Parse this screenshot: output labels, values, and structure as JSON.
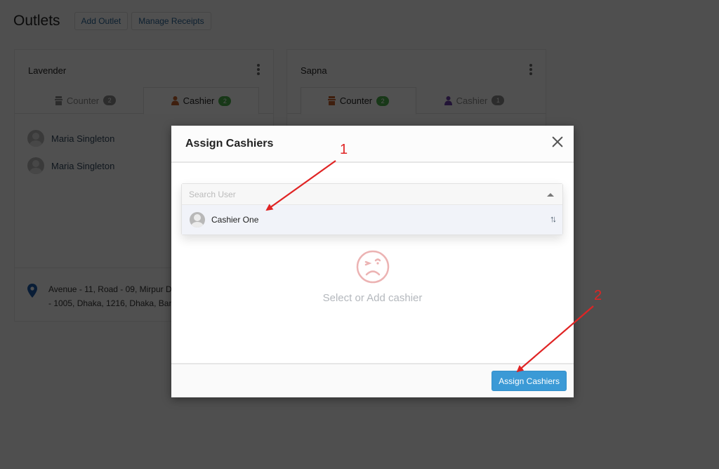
{
  "page": {
    "title": "Outlets",
    "buttons": [
      "Add Outlet",
      "Manage Receipts"
    ]
  },
  "outlets": [
    {
      "name": "Lavender",
      "tabs": [
        {
          "label": "Counter",
          "count": "2",
          "active": false
        },
        {
          "label": "Cashier",
          "count": "2",
          "active": true
        }
      ],
      "people": [
        "Maria Singleton",
        "Maria Singleton"
      ],
      "address_line1": "Avenue - 11, Road - 09, Mirpur D",
      "address_line2": "- 1005, Dhaka, 1216, Dhaka, Ban"
    },
    {
      "name": "Sapna",
      "tabs": [
        {
          "label": "Counter",
          "count": "2",
          "active": true
        },
        {
          "label": "Cashier",
          "count": "1",
          "active": false
        }
      ]
    }
  ],
  "modal": {
    "title": "Assign Cashiers",
    "search_placeholder": "Search User",
    "options": [
      {
        "label": "Cashier One"
      }
    ],
    "empty_text": "Select or Add cashier",
    "submit_label": "Assign Cashiers"
  },
  "annotations": [
    {
      "number": "1",
      "target": "Cashier One option"
    },
    {
      "number": "2",
      "target": "Assign Cashiers button"
    }
  ],
  "colors": {
    "primary": "#3b9ad6",
    "badge_active": "#4cae4c",
    "annotation": "#e02424",
    "empty_icon": "#e8a5a5"
  }
}
